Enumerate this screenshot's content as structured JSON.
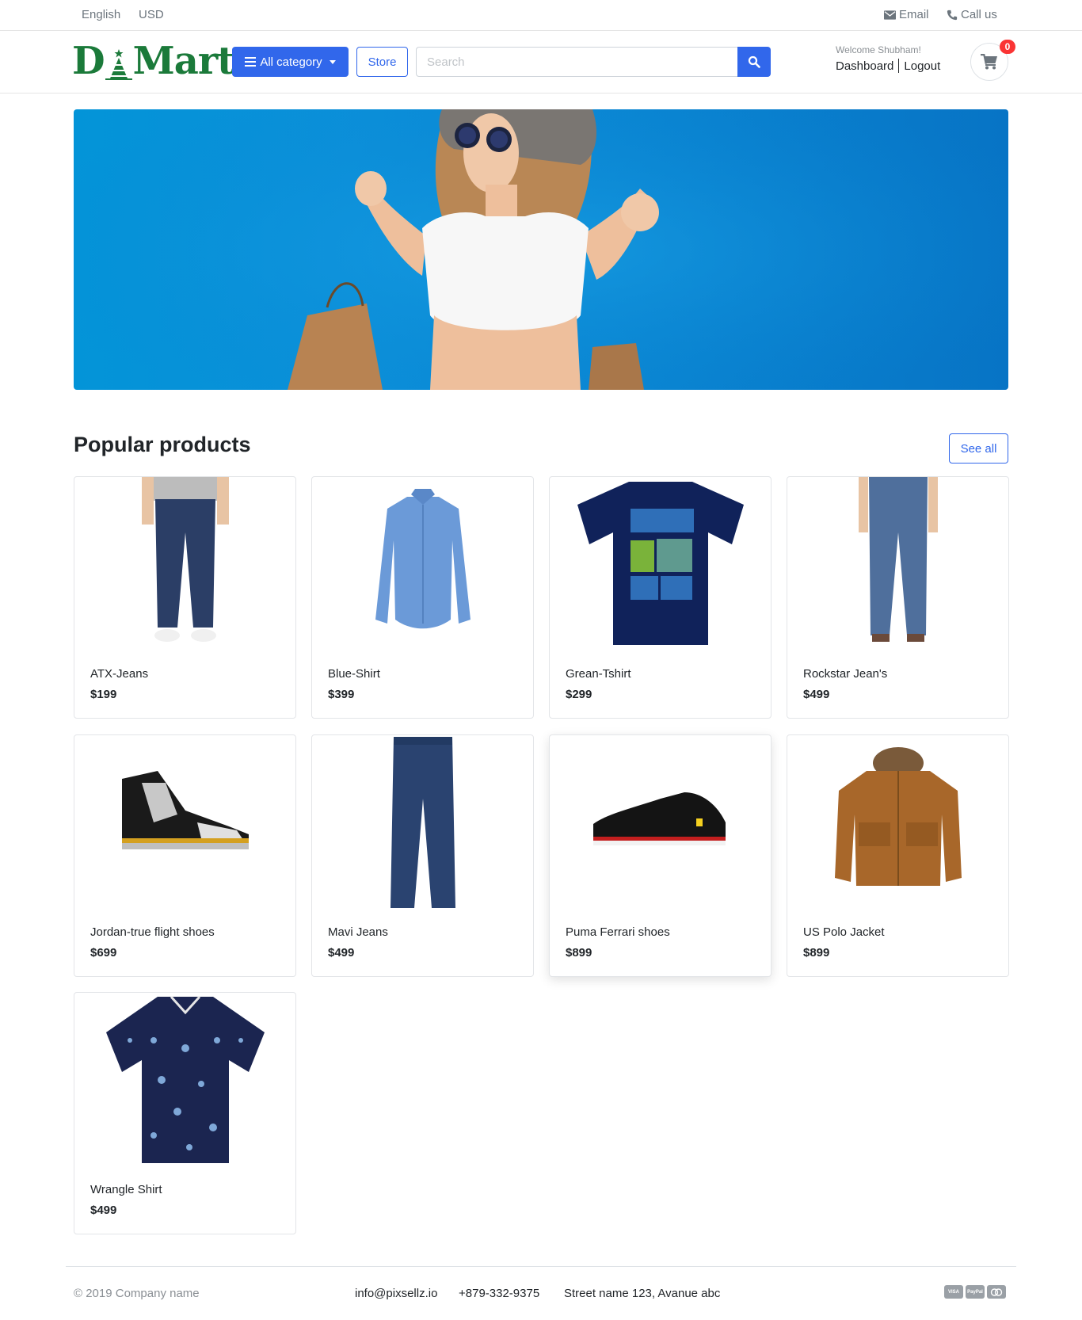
{
  "topbar": {
    "language": "English",
    "currency": "USD",
    "email_label": "Email",
    "call_label": "Call us"
  },
  "header": {
    "logo_left": "D",
    "logo_right": "Mart",
    "category_button": "All category",
    "store_button": "Store",
    "search_placeholder": "Search",
    "welcome": "Welcome Shubham!",
    "dashboard": "Dashboard",
    "logout": "Logout",
    "cart_count": "0"
  },
  "section": {
    "title": "Popular products",
    "see_all": "See all"
  },
  "products": [
    {
      "name": "ATX-Jeans",
      "price": "$199"
    },
    {
      "name": "Blue-Shirt",
      "price": "$399"
    },
    {
      "name": "Grean-Tshirt",
      "price": "$299"
    },
    {
      "name": "Rockstar Jean's",
      "price": "$499"
    },
    {
      "name": "Jordan-true flight shoes",
      "price": "$699"
    },
    {
      "name": "Mavi Jeans",
      "price": "$499"
    },
    {
      "name": "Puma Ferrari shoes",
      "price": "$899"
    },
    {
      "name": "US Polo Jacket",
      "price": "$899"
    },
    {
      "name": "Wrangle Shirt",
      "price": "$499"
    }
  ],
  "footer": {
    "copyright": "© 2019 Company name",
    "email": "info@pixsellz.io",
    "phone": "+879-332-9375",
    "address": "Street name 123, Avanue abc",
    "payments": [
      "VISA",
      "PayPal",
      "MC"
    ]
  },
  "colors": {
    "primary": "#3167eb",
    "brand_green": "#1b7a3a",
    "badge_red": "#fa3434",
    "banner_blue": "#0a85d2"
  },
  "icons": {
    "email": "envelope-icon",
    "call": "phone-icon",
    "menu": "bars-icon",
    "search": "search-icon",
    "cart": "shopping-cart-icon"
  }
}
